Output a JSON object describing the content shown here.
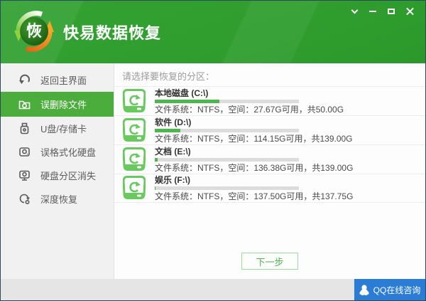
{
  "window": {
    "title": "快易数据恢复",
    "logo_char": "恢"
  },
  "sidebar": {
    "items": [
      {
        "label": "返回主界面",
        "icon": "return-arrow-icon",
        "active": false
      },
      {
        "label": "误删除文件",
        "icon": "folder-restore-icon",
        "active": true
      },
      {
        "label": "U盘/存储卡",
        "icon": "usb-drive-icon",
        "active": false
      },
      {
        "label": "误格式化硬盘",
        "icon": "hard-drive-icon",
        "active": false
      },
      {
        "label": "硬盘分区消失",
        "icon": "partition-lost-icon",
        "active": false
      },
      {
        "label": "深度恢复",
        "icon": "deep-recovery-icon",
        "active": false
      }
    ]
  },
  "main": {
    "prompt": "请选择要恢复的分区：",
    "drives": [
      {
        "name": "本地磁盘 (C:\\)",
        "info": "文件系统：NTFS，空间：27.67G可用，共50.00G",
        "used_percent": 44.7
      },
      {
        "name": "软件 (D:\\)",
        "info": "文件系统：NTFS，空间：114.15G可用，共139.00G",
        "used_percent": 17.9
      },
      {
        "name": "文档 (E:\\)",
        "info": "文件系统：NTFS，空间：136.38G可用，共139.00G",
        "used_percent": 1.9
      },
      {
        "name": "娱乐 (F:\\)",
        "info": "文件系统：NTFS，空间：137.50G可用，共137.75G",
        "used_percent": 0.5
      }
    ],
    "next_button": "下一步"
  },
  "footer": {
    "qq_label": "QQ在线咨询"
  },
  "colors": {
    "header_green": "#2f9e2e",
    "selected_green": "#4bae3c",
    "icon_green": "#67c95e",
    "bar_green": "#4cb74c",
    "qq_blue": "#2a7cd5"
  }
}
